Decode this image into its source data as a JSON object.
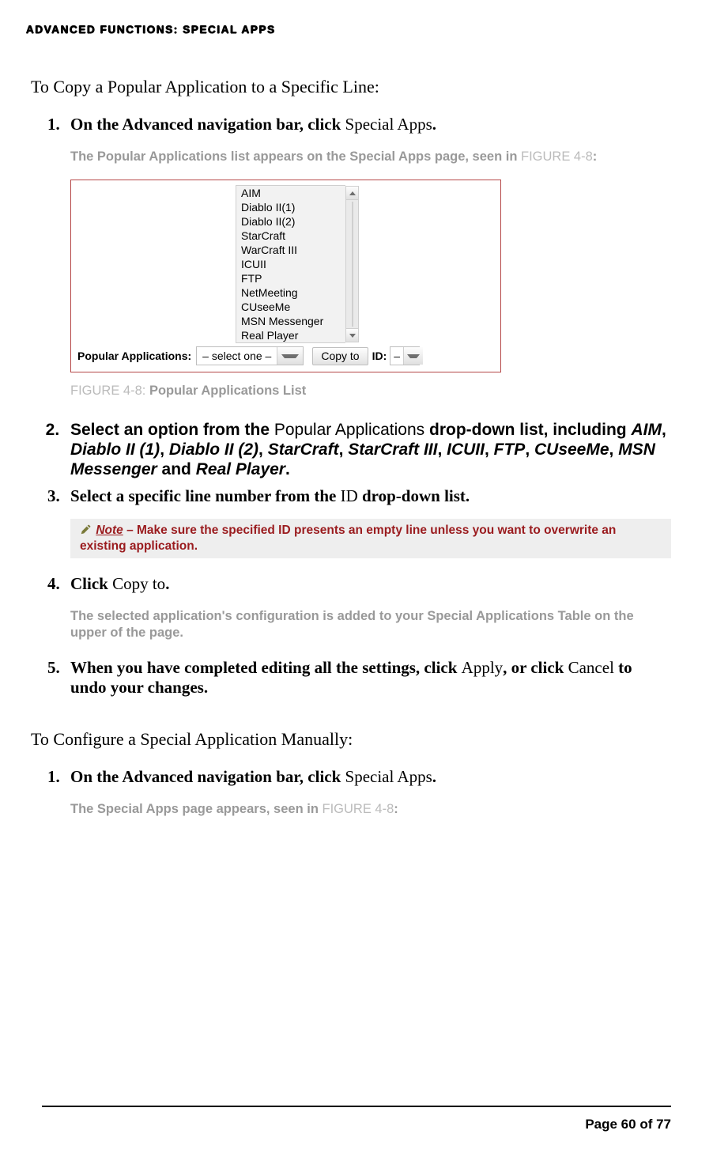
{
  "header": {
    "running": "ADVANCED FUNCTIONS: SPECIAL APPS"
  },
  "sectionA": {
    "lead": "To Copy a Popular Application to a Specific Line:",
    "steps": {
      "s1": {
        "pre_bold": "On the Advanced navigation bar, click ",
        "link": "Special Apps",
        "post_bold": "."
      },
      "desc1": {
        "pre": "The Popular Applications list appears on the Special Apps page, seen in ",
        "figref": "FIGURE 4-8",
        "post": ":"
      },
      "figcaption": {
        "label": "FIGURE 4-8: ",
        "text": "Popular Applications List"
      },
      "s2": {
        "pre": "Select an option from the ",
        "mid": "Popular Applications",
        "post": " drop-down list, including ",
        "apps": {
          "a1": "AIM",
          "c1": ", ",
          "a2": "Diablo II (1)",
          "c2": ", ",
          "a3": "Diablo II (2)",
          "c3": ", ",
          "a4": "StarCraft",
          "c4": ", ",
          "a5": "StarCraft III",
          "c5": ", ",
          "a6": "ICUII",
          "c6": ", ",
          "a7": "FTP",
          "c7": ", ",
          "a8": "CUseeMe",
          "c8": ", ",
          "a9": "MSN Messenger",
          "c9": " and ",
          "a10": "Real Player"
        },
        "end": "."
      },
      "s3": {
        "pre": "Select a specific line number from the ",
        "mid": "ID",
        "post": " drop-down list."
      },
      "note": {
        "word": "Note",
        "dash": " – ",
        "text": "Make sure the specified ID presents an empty line unless you want to overwrite an existing application."
      },
      "s4": {
        "pre": "Click ",
        "mid": "Copy to",
        "post": "."
      },
      "desc4": "The selected application's configuration is added to your Special Applications Table on the upper of the page.",
      "s5": {
        "t1": "When you have completed editing all the settings, click ",
        "a": "Apply",
        "t2": ", or click ",
        "b": "Cancel",
        "t3": " to undo your changes."
      }
    }
  },
  "sectionB": {
    "lead": "To Configure a Special Application Manually:",
    "steps": {
      "s1": {
        "pre_bold": "On the Advanced navigation bar, click ",
        "link": "Special Apps",
        "post_bold": "."
      },
      "desc1": {
        "pre": "The Special Apps page appears, seen in ",
        "figref": "FIGURE 4-8",
        "post": ":"
      }
    }
  },
  "figure": {
    "label_popular": "Popular Applications:",
    "combo_value": "– select one –",
    "copy_btn": "Copy to",
    "label_id": "ID:",
    "id_value": "–",
    "list": {
      "i0": "AIM",
      "i1": "Diablo II(1)",
      "i2": "Diablo II(2)",
      "i3": "StarCraft",
      "i4": "WarCraft III",
      "i5": "ICUII",
      "i6": "FTP",
      "i7": "NetMeeting",
      "i8": "CUseeMe",
      "i9": "MSN Messenger",
      "i10": "Real Player"
    }
  },
  "footer": {
    "page": "Page 60 of 77"
  }
}
